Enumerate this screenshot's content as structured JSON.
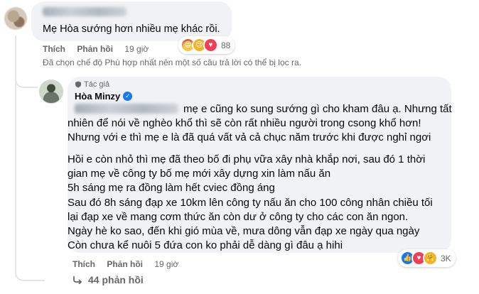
{
  "top_comment": {
    "text": "Mẹ Hòa sướng hơn nhiều mẹ khác rồi.",
    "like_label": "Thích",
    "reply_label": "Phản hồi",
    "time": "19 giờ",
    "reaction_count": "88",
    "reactions": [
      "angry-react-icon",
      "sad-react-icon",
      "love-react-icon"
    ]
  },
  "filter_note": "Đã chọn chế độ Phù hợp nhất nên một số câu trả lời có thể bị lọc ra.",
  "reply": {
    "author_badge": "Tác giả",
    "author_name": "Hòa Minzy",
    "lines": [
      "mẹ e cũng ko sung sướng gì cho kham đâu ạ. Nhưng tất",
      "nhiên để nói về nghèo khổ thì sẽ còn rất nhiều người trong csong khổ hơn!",
      "Nhưng với e thì mẹ e là đã quá vất vả cả chục năm trước khi được nghỉ ngơi",
      "Hồi e còn nhỏ thì mẹ đã theo bố đi phụ vữa xây nhà khắp nơi, sau đó 1 thời",
      "gian mẹ về công ty bố mẹ mới xây dựng xin làm nấu ăn",
      "5h sáng mẹ ra đồng làm hết cviec đồng áng",
      "Sau đó 8h sáng đạp xe 10km lên công ty nấu ăn cho 100 công nhân chiều tối",
      "lại đạp xe về mang cơm thức ăn còn dư ở công ty cho các con ăn ngon.",
      "Ngày hè ko sao, đến khi gió mùa về, mưa dông vẫn đạp xe ngày qua ngày",
      "Còn chưa kể nuôi 5 đứa con ko phải dễ dàng gì đâu ạ hihi"
    ],
    "like_label": "Thích",
    "reply_label": "Phản hồi",
    "time": "19 giờ",
    "reaction_count": "3K",
    "reactions": [
      "like-react-icon",
      "love-react-icon",
      "care-react-icon"
    ]
  },
  "more_replies": "44 phản hồi"
}
